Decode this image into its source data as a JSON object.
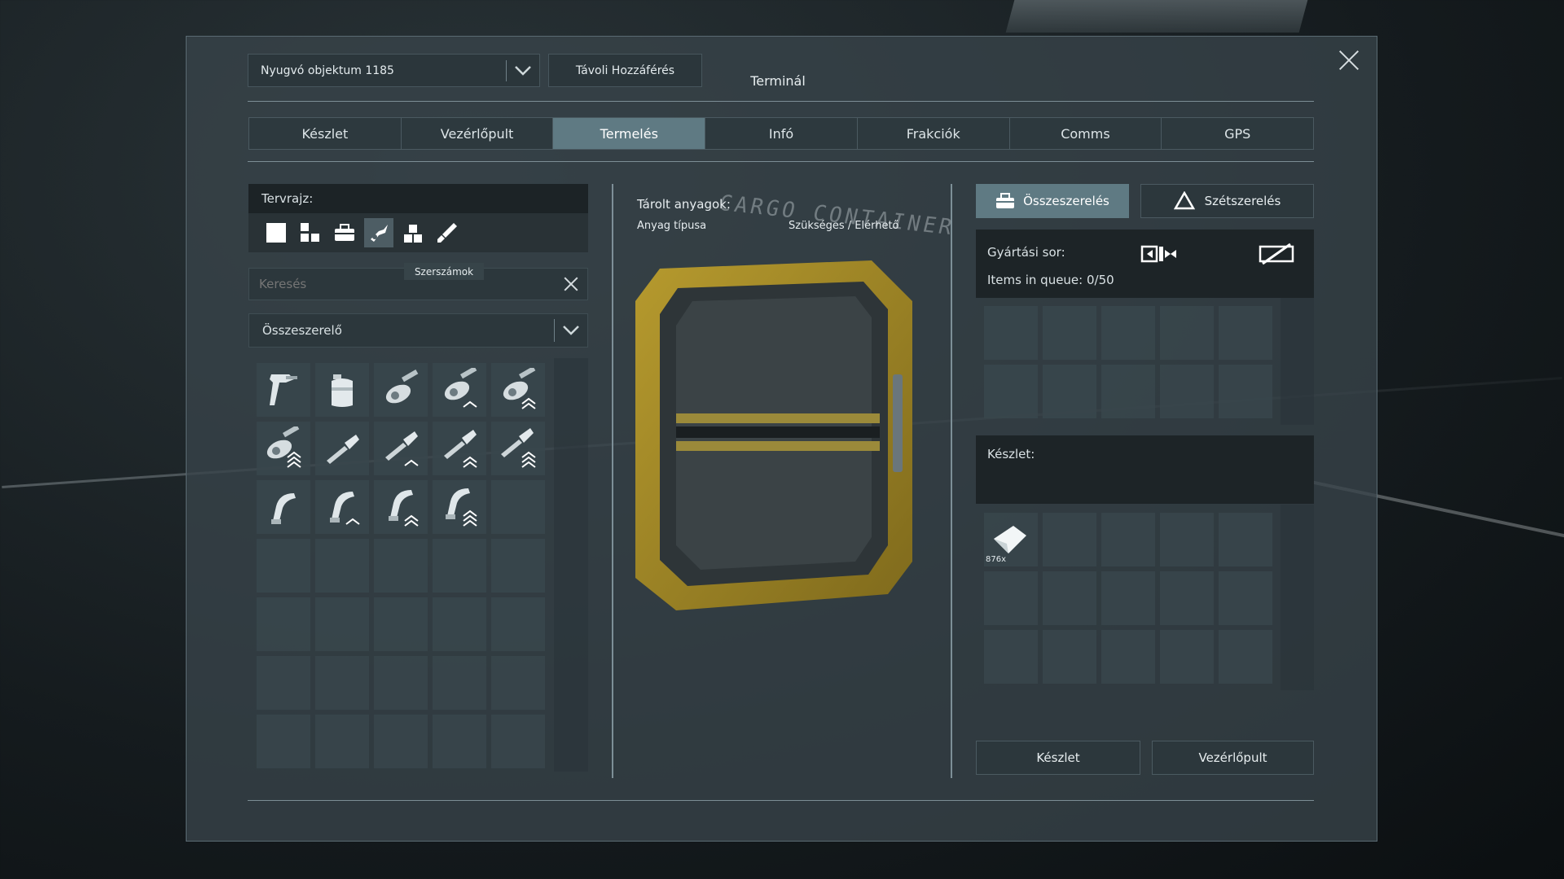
{
  "header": {
    "object_selector": "Nyugvó objektum 1185",
    "remote_access": "Távoli Hozzáférés",
    "title": "Terminál"
  },
  "tabs": [
    {
      "label": "Készlet"
    },
    {
      "label": "Vezérlőpult"
    },
    {
      "label": "Termelés",
      "active": true
    },
    {
      "label": "Infó"
    },
    {
      "label": "Frakciók"
    },
    {
      "label": "Comms"
    },
    {
      "label": "GPS"
    }
  ],
  "blueprint": {
    "label": "Tervrajz:",
    "filter_icons": [
      "all-square-icon",
      "components-icon",
      "toolbox-icon",
      "tools-icon",
      "blocks-icon",
      "paint-icon"
    ],
    "tooltip": "Szerszámok",
    "search_placeholder": "Keresés",
    "assembler": "Összeszerelő",
    "items": [
      {
        "icon": "paint-gun-icon",
        "tier": 0
      },
      {
        "icon": "canister-icon",
        "tier": 0
      },
      {
        "icon": "grinder-icon",
        "tier": 0
      },
      {
        "icon": "grinder-icon",
        "tier": 1
      },
      {
        "icon": "grinder-icon",
        "tier": 2
      },
      {
        "icon": "grinder-icon",
        "tier": 3
      },
      {
        "icon": "drill-icon",
        "tier": 0
      },
      {
        "icon": "drill-icon",
        "tier": 1
      },
      {
        "icon": "drill-icon",
        "tier": 2
      },
      {
        "icon": "drill-icon",
        "tier": 3
      },
      {
        "icon": "welder-icon",
        "tier": 0
      },
      {
        "icon": "welder-icon",
        "tier": 1
      },
      {
        "icon": "welder-icon",
        "tier": 2
      },
      {
        "icon": "welder-icon",
        "tier": 3
      }
    ]
  },
  "center": {
    "stored_materials": "Tárolt anyagok:",
    "material_type": "Anyag típusa",
    "required_available": "Szükséges / Elérhető"
  },
  "right": {
    "assemble": "Összeszerelés",
    "disassemble": "Szétszerelés",
    "queue_label": "Gyártási sor:",
    "queue_count": "Items in queue: 0/50",
    "inventory_label": "Készlet:",
    "inventory_item_count": "876x",
    "inventory_item_icon": "ice-crystal-icon"
  },
  "bottom": {
    "inventory_button": "Készlet",
    "control_panel_button": "Vezérlőpult"
  }
}
